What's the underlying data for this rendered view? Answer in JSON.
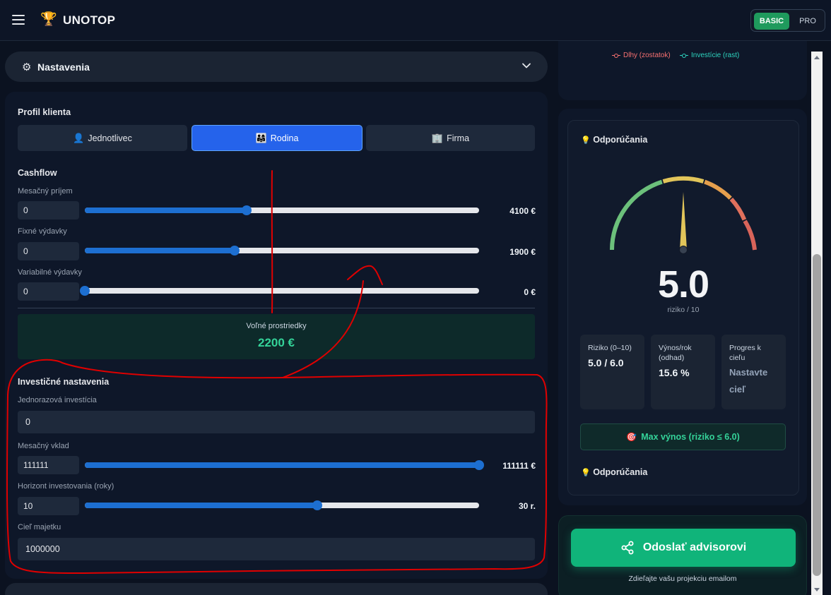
{
  "header": {
    "brand": "UNOTOP",
    "plans": {
      "basic": "BASIC",
      "pro": "PRO"
    }
  },
  "settings": {
    "title": "Nastavenia"
  },
  "profile": {
    "title": "Profil klienta",
    "options": [
      {
        "label": "Jednotlivec",
        "icon": "person-icon",
        "active": false
      },
      {
        "label": "Rodina",
        "icon": "family-icon",
        "active": true
      },
      {
        "label": "Firma",
        "icon": "building-icon",
        "active": false
      }
    ]
  },
  "cashflow": {
    "title": "Cashflow",
    "income": {
      "label": "Mesačný príjem",
      "input": "0",
      "value": "4100 €",
      "level": 0.41
    },
    "fixed": {
      "label": "Fixné výdavky",
      "input": "0",
      "value": "1900 €",
      "level": 0.38
    },
    "variable": {
      "label": "Variabilné výdavky",
      "input": "0",
      "value": "0 €",
      "level": 0.0
    },
    "free": {
      "label": "Voľné prostriedky",
      "value": "2200 €"
    }
  },
  "investment": {
    "title": "Investičné nastavenia",
    "lump": {
      "label": "Jednorazová investícia",
      "value": "0"
    },
    "monthly": {
      "label": "Mesačný vklad",
      "input": "111111",
      "value": "111111 €",
      "level": 1.0
    },
    "horizon": {
      "label": "Horizont investovania (roky)",
      "input": "10",
      "value": "30 r.",
      "level": 0.59
    },
    "goal": {
      "label": "Cieľ majetku",
      "value": "1000000"
    }
  },
  "right": {
    "legend": {
      "debt": {
        "label": "Dlhy (zostatok)",
        "color": "#f87171"
      },
      "invest": {
        "label": "Investície (rast)",
        "color": "#2dd4bf"
      }
    },
    "recommendations_title": "Odporúčania",
    "gauge": {
      "score": "5.0",
      "sub": "riziko / 10",
      "value": 5.0
    },
    "stats": [
      {
        "label": "Riziko (0–10)",
        "value": "5.0 / 6.0"
      },
      {
        "label": "Výnos/rok (odhad)",
        "value": "15.6 %"
      },
      {
        "label": "Progres k cieľu",
        "value": "Nastavte cieľ"
      }
    ],
    "max_button": "Max výnos (riziko ≤ 6.0)",
    "recommendations_title_2": "Odporúčania",
    "send_button": "Odoslať advisorovi",
    "send_sub": "Zdieľajte vašu projekciu emailom"
  }
}
